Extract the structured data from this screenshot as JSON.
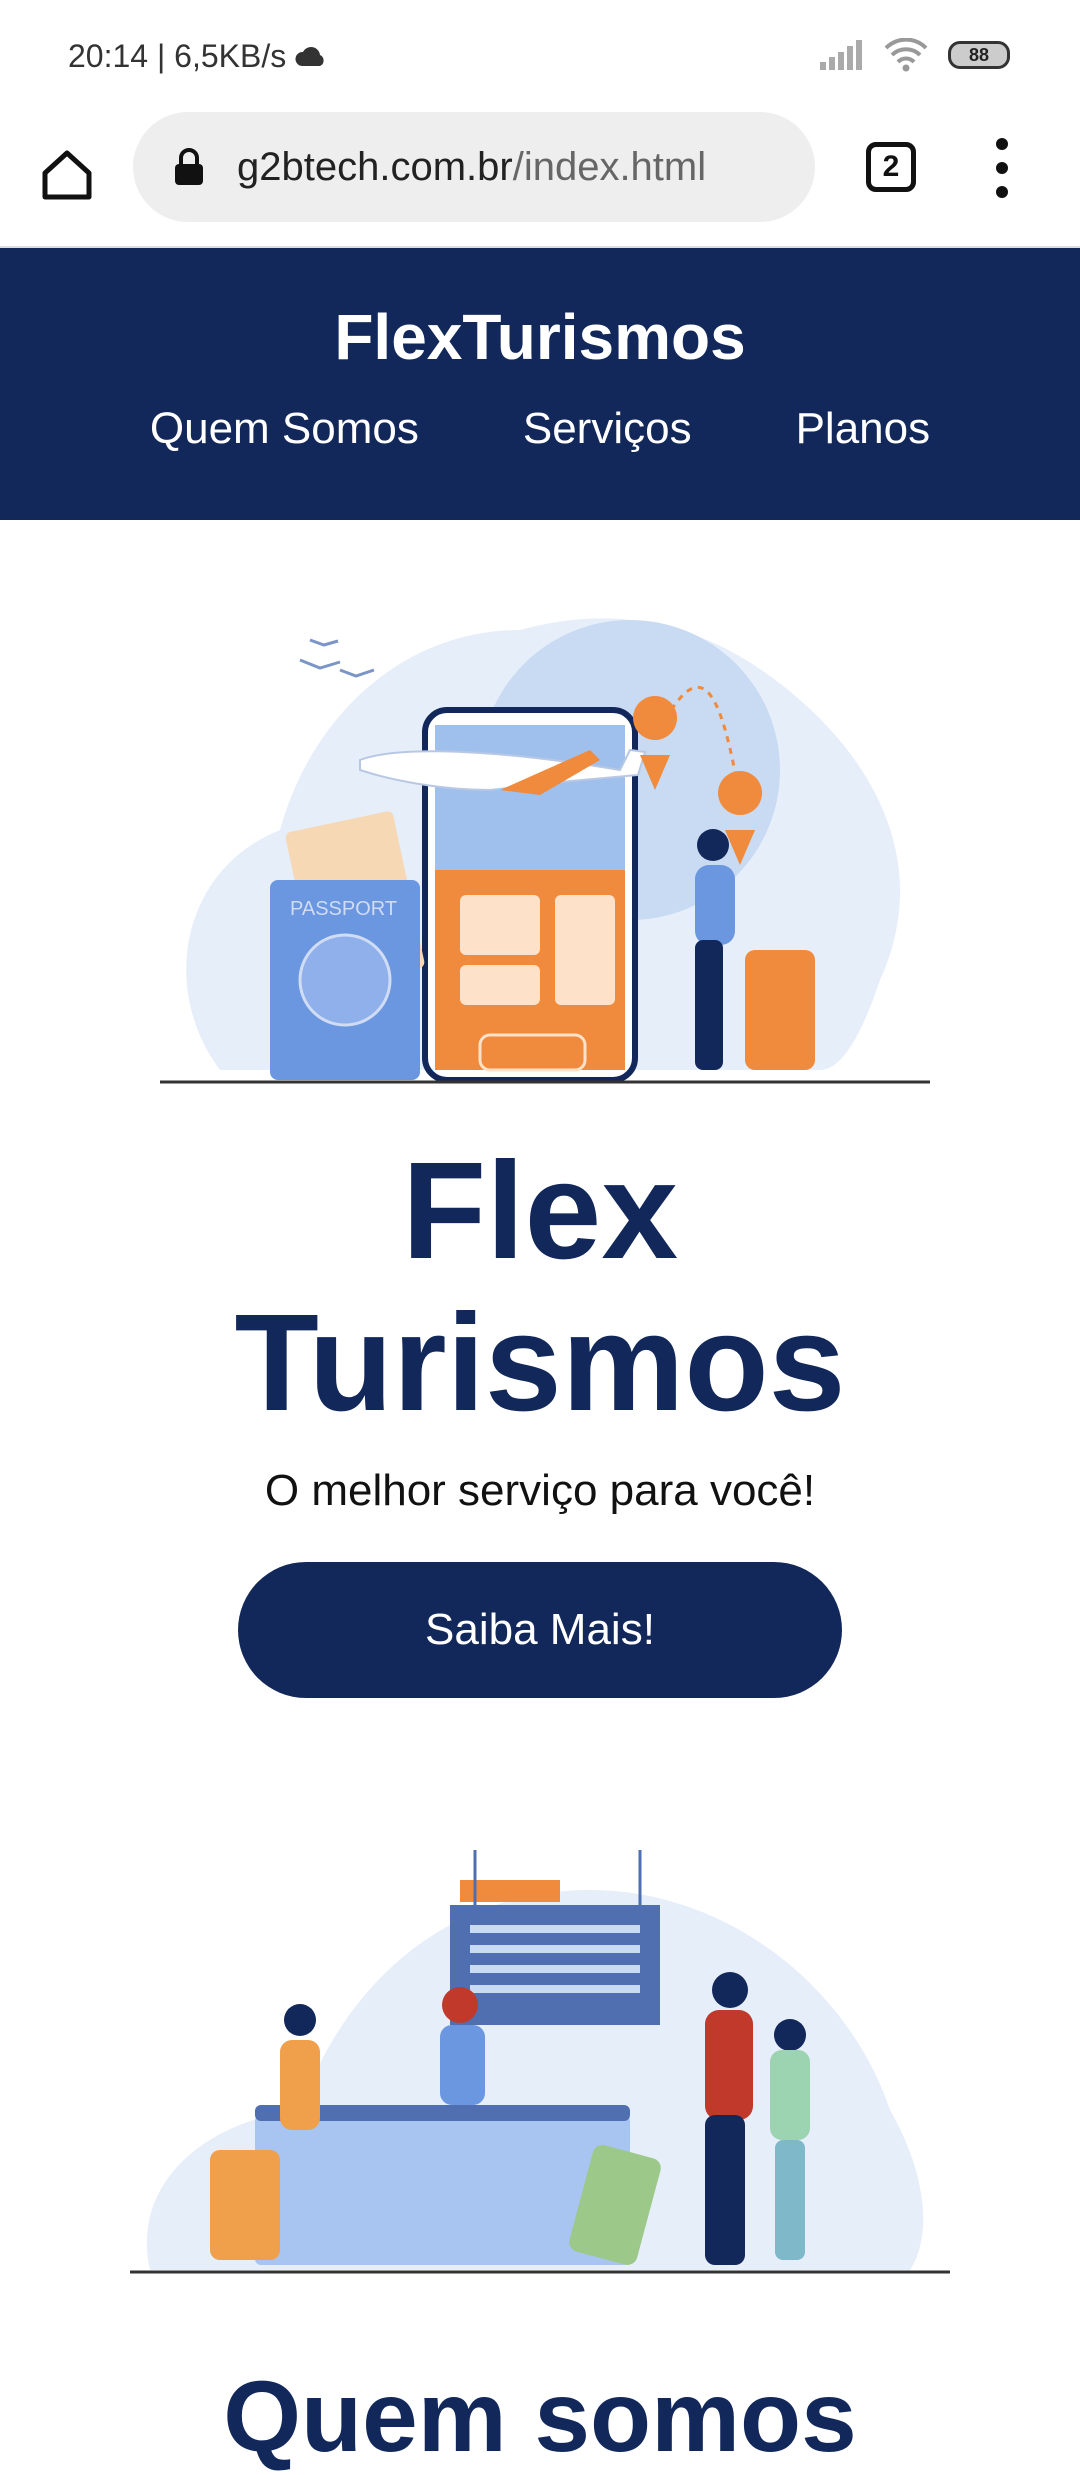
{
  "status": {
    "time_speed": "20:14 | 6,5KB/s",
    "battery": "88"
  },
  "browser": {
    "url_host": "g2btech.com.br",
    "url_path": "/index.html",
    "tab_count": "2"
  },
  "site": {
    "brand": "FlexTurismos",
    "nav": [
      "Quem Somos",
      "Serviços",
      "Planos"
    ]
  },
  "hero": {
    "title_line1": "Flex",
    "title_line2": "Turismos",
    "subtitle": "O melhor serviço para você!",
    "cta": "Saiba Mais!",
    "passport_label": "PASSPORT"
  },
  "next_section": {
    "title": "Quem somos"
  },
  "colors": {
    "brand": "#13285a",
    "accent": "#f08a3c",
    "light_blue": "#e6eefa"
  }
}
